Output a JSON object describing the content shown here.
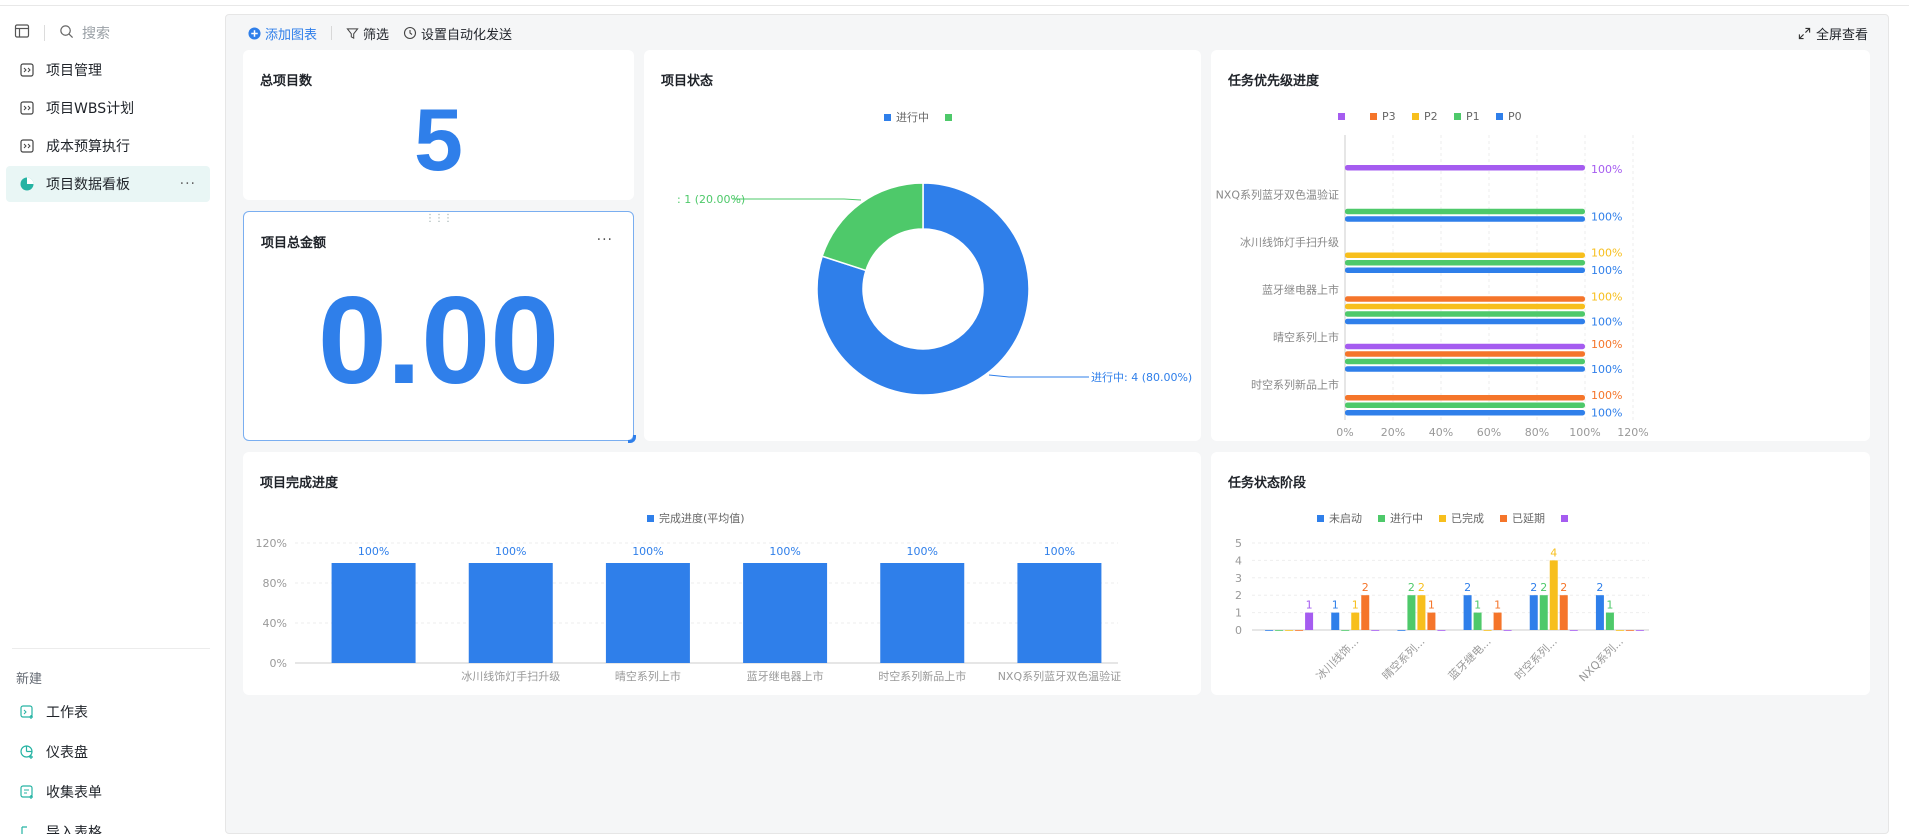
{
  "sidebar": {
    "search_placeholder": "搜索",
    "items": [
      {
        "label": "项目管理",
        "icon": "sheet-icon"
      },
      {
        "label": "项目WBS计划",
        "icon": "sheet-icon"
      },
      {
        "label": "成本预算执行",
        "icon": "sheet-icon"
      },
      {
        "label": "项目数据看板",
        "icon": "dashboard-icon",
        "active": true,
        "more": "···"
      }
    ],
    "new_section_label": "新建",
    "new_items": [
      {
        "label": "工作表",
        "icon": "add-sheet-icon"
      },
      {
        "label": "仪表盘",
        "icon": "add-dashboard-icon"
      },
      {
        "label": "收集表单",
        "icon": "form-icon"
      },
      {
        "label": "导入表格",
        "icon": "import-icon"
      }
    ]
  },
  "toolbar": {
    "add_chart": "添加图表",
    "filter": "筛选",
    "automation": "设置自动化发送",
    "fullscreen": "全屏查看"
  },
  "colors": {
    "blue": "#2f7fea",
    "green": "#4ec96a",
    "yellow": "#f7bf1d",
    "orange": "#f5752a",
    "purple": "#a55cf0"
  },
  "cards": {
    "total_projects": {
      "title": "总项目数",
      "value": "5"
    },
    "total_amount": {
      "title": "项目总金额",
      "value": "0.00",
      "more": "···"
    },
    "project_status": {
      "title": "项目状态"
    },
    "task_priority": {
      "title": "任务优先级进度"
    },
    "project_completion": {
      "title": "项目完成进度"
    },
    "task_stage": {
      "title": "任务状态阶段"
    }
  },
  "chart_data": [
    {
      "id": "project_status",
      "type": "pie",
      "donut": true,
      "legend": [
        "进行中",
        ""
      ],
      "slices": [
        {
          "name": "进行中",
          "value": 4,
          "percent": 80.0,
          "color": "#2f7fea",
          "label": "进行中: 4 (80.00%)"
        },
        {
          "name": "",
          "value": 1,
          "percent": 20.0,
          "color": "#4ec96a",
          "label": ": 1 (20.00%)"
        }
      ]
    },
    {
      "id": "task_priority",
      "type": "bar",
      "orientation": "horizontal",
      "legend": [
        "",
        "P3",
        "P2",
        "P1",
        "P0"
      ],
      "categories": [
        "",
        "NXQ系列蓝牙双色温验证",
        "冰川线饰灯手扫升级",
        "蓝牙继电器上市",
        "晴空系列上市",
        "时空系列新品上市"
      ],
      "series": [
        {
          "name": "",
          "color": "#a55cf0",
          "values": [
            100,
            null,
            null,
            null,
            100,
            null
          ]
        },
        {
          "name": "P3",
          "color": "#f5752a",
          "values": [
            null,
            null,
            null,
            100,
            100,
            100
          ]
        },
        {
          "name": "P2",
          "color": "#f7bf1d",
          "values": [
            null,
            null,
            100,
            100,
            null,
            null
          ]
        },
        {
          "name": "P1",
          "color": "#4ec96a",
          "values": [
            null,
            100,
            100,
            100,
            100,
            100
          ]
        },
        {
          "name": "P0",
          "color": "#2f7fea",
          "values": [
            null,
            100,
            100,
            100,
            100,
            100
          ]
        }
      ],
      "labels": [
        [
          {
            "text": "100%",
            "color": "#a55cf0"
          }
        ],
        [
          {
            "text": "100%",
            "color": "#2f7fea"
          }
        ],
        [
          {
            "text": "100%",
            "color": "#f7bf1d"
          },
          {
            "text": "100%",
            "color": "#2f7fea"
          }
        ],
        [
          {
            "text": "100%",
            "color": "#f7bf1d"
          },
          {
            "text": "100%",
            "color": "#2f7fea"
          }
        ],
        [
          {
            "text": "100%",
            "color": "#f5752a"
          },
          {
            "text": "100%",
            "color": "#2f7fea"
          }
        ],
        [
          {
            "text": "100%",
            "color": "#f5752a"
          },
          {
            "text": "100%",
            "color": "#2f7fea"
          }
        ]
      ],
      "xticks": [
        "0%",
        "20%",
        "40%",
        "60%",
        "80%",
        "100%",
        "120%"
      ],
      "xlim": [
        0,
        120
      ],
      "grid": true
    },
    {
      "id": "project_completion",
      "type": "bar",
      "legend": [
        "完成进度(平均值)"
      ],
      "categories": [
        "",
        "冰川线饰灯手扫升级",
        "晴空系列上市",
        "蓝牙继电器上市",
        "时空系列新品上市",
        "NXQ系列蓝牙双色温验证"
      ],
      "values": [
        100,
        100,
        100,
        100,
        100,
        100
      ],
      "value_labels": [
        "100%",
        "100%",
        "100%",
        "100%",
        "100%",
        "100%"
      ],
      "yticks": [
        "0%",
        "40%",
        "80%",
        "120%"
      ],
      "ylim": [
        0,
        120
      ],
      "color": "#2f7fea"
    },
    {
      "id": "task_stage",
      "type": "bar",
      "legend": [
        "未启动",
        "进行中",
        "已完成",
        "已延期",
        ""
      ],
      "categories": [
        "",
        "冰川线饰...",
        "晴空系列...",
        "蓝牙继电...",
        "时空系列...",
        "NXQ系列..."
      ],
      "series": [
        {
          "name": "未启动",
          "color": "#2f7fea",
          "values": [
            0,
            1,
            0,
            2,
            2,
            2
          ]
        },
        {
          "name": "进行中",
          "color": "#4ec96a",
          "values": [
            0,
            0,
            2,
            1,
            2,
            1
          ]
        },
        {
          "name": "已完成",
          "color": "#f7bf1d",
          "values": [
            0,
            1,
            2,
            0,
            4,
            0
          ]
        },
        {
          "name": "已延期",
          "color": "#f5752a",
          "values": [
            0,
            2,
            1,
            1,
            2,
            0
          ]
        },
        {
          "name": "",
          "color": "#a55cf0",
          "values": [
            1,
            0,
            0,
            0,
            0,
            0
          ]
        }
      ],
      "yticks": [
        "0",
        "1",
        "2",
        "3",
        "4",
        "5"
      ],
      "ylim": [
        0,
        5
      ]
    }
  ]
}
